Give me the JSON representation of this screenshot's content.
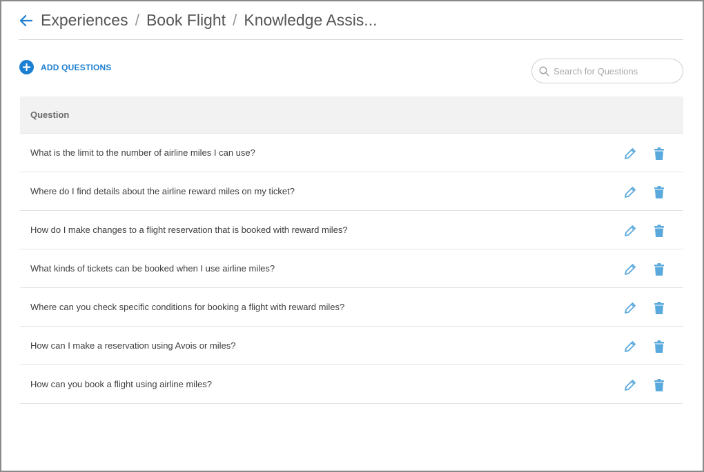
{
  "breadcrumb": {
    "items": [
      "Experiences",
      "Book Flight",
      "Knowledge Assis..."
    ],
    "separator": "/"
  },
  "toolbar": {
    "add_label": "ADD QUESTIONS",
    "search_placeholder": "Search for Questions"
  },
  "table": {
    "header": "Question",
    "rows": [
      "What is the limit to the number of airline miles I can use?",
      "Where do I find details about the airline reward miles on my ticket?",
      "How do I make changes to a flight reservation that is booked with reward miles?",
      "What kinds of tickets can be booked when I use airline miles?",
      "Where can you check specific conditions for booking a flight with reward miles?",
      "How can I make a reservation using Avois or miles?",
      "How can you book a flight using airline miles?"
    ]
  },
  "icons": {
    "back": "arrow-left-icon",
    "add": "plus-circle-icon",
    "search": "search-icon",
    "edit": "pencil-icon",
    "delete": "trash-icon"
  },
  "colors": {
    "accent": "#1d7fd0",
    "action_icon": "#5aa9dc",
    "header_bg": "#f2f2f2"
  }
}
